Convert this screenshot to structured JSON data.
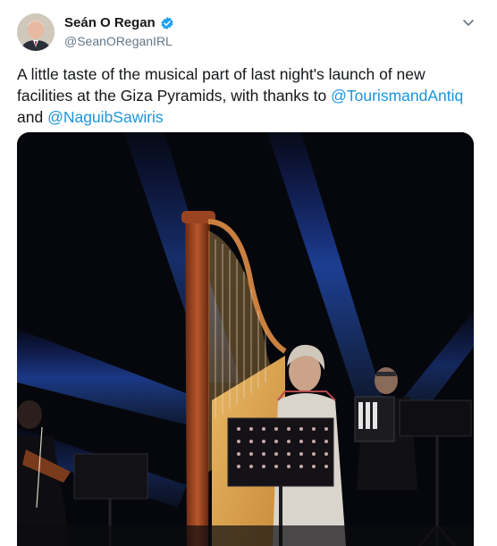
{
  "tweet": {
    "author": {
      "display_name": "Seán O Regan",
      "handle": "@SeanOReganIRL",
      "verified": true,
      "avatar_icon": "profile-photo"
    },
    "text_before": "A little taste of the musical part of last night's launch of new facilities at the Giza Pyramids, with thanks to ",
    "mention_1": "@TourismandAntiq",
    "text_between": " and ",
    "mention_2": "@NaguibSawiris",
    "menu_icon": "chevron-down-icon",
    "media": {
      "type": "video",
      "content": "concert-stage-harp-performance"
    },
    "colors": {
      "link": "#1b95e0",
      "verified_badge": "#1da1f2",
      "handle_text": "#657786"
    }
  }
}
